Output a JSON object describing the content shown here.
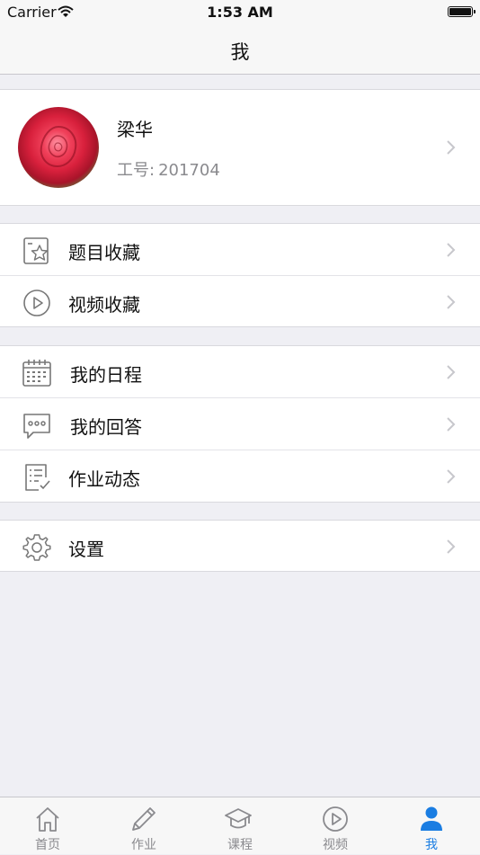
{
  "status_bar": {
    "carrier": "Carrier",
    "time": "1:53 AM"
  },
  "nav": {
    "title": "我"
  },
  "profile": {
    "name": "梁华",
    "employee_label": "工号:",
    "employee_id": "201704"
  },
  "groups": [
    {
      "items": [
        {
          "label": "题目收藏",
          "icon": "star-note-icon"
        },
        {
          "label": "视频收藏",
          "icon": "play-circle-icon"
        }
      ]
    },
    {
      "items": [
        {
          "label": "我的日程",
          "icon": "calendar-icon"
        },
        {
          "label": "我的回答",
          "icon": "chat-bubble-icon"
        },
        {
          "label": "作业动态",
          "icon": "checklist-icon"
        }
      ]
    },
    {
      "items": [
        {
          "label": "设置",
          "icon": "gear-icon"
        }
      ]
    }
  ],
  "tabs": [
    {
      "label": "首页",
      "icon": "home-icon",
      "active": false
    },
    {
      "label": "作业",
      "icon": "pencil-icon",
      "active": false
    },
    {
      "label": "课程",
      "icon": "graduation-cap-icon",
      "active": false
    },
    {
      "label": "视频",
      "icon": "play-circle-icon",
      "active": false
    },
    {
      "label": "我",
      "icon": "person-icon",
      "active": true
    }
  ],
  "colors": {
    "accent": "#1a7de2",
    "background": "#efeff4",
    "icon_gray": "#777777",
    "chevron": "#c7c7cc"
  }
}
